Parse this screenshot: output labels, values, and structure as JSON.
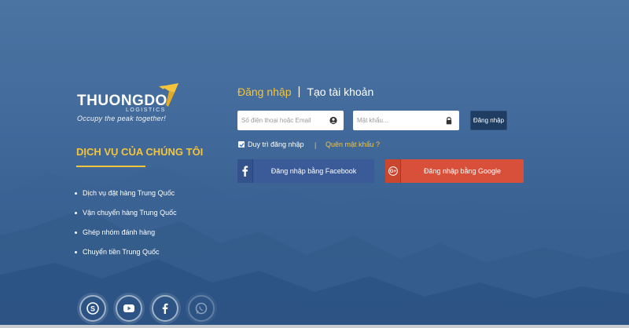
{
  "logo": {
    "name": "THUONGDO",
    "sub": "LOGISTICS",
    "tagline": "Occupy the peak together!"
  },
  "services": {
    "title": "DỊCH VỤ CỦA CHÚNG TÔI",
    "items": [
      {
        "label": "Dịch vụ đặt hàng Trung Quốc"
      },
      {
        "label": "Vận chuyển hàng Trung Quốc"
      },
      {
        "label": "Ghép nhóm đánh hàng"
      },
      {
        "label": "Chuyển tiền Trung Quốc"
      }
    ]
  },
  "social": [
    {
      "icon": "skype-icon"
    },
    {
      "icon": "youtube-icon"
    },
    {
      "icon": "facebook-icon"
    },
    {
      "icon": "whatsapp-icon"
    }
  ],
  "tabs": {
    "login": "Đăng nhập",
    "separator": "|",
    "register": "Tạo tài khoản"
  },
  "form": {
    "username_placeholder": "Số điện thoại hoặc Email",
    "username_value": "",
    "password_placeholder": "Mật khẩu...",
    "password_value": "",
    "login_button": "Đăng nhập",
    "remember_label": "Duy trì đăng nhập",
    "remember_checked": true,
    "divider": "|",
    "forgot_label": "Quên mật khẩu ?"
  },
  "social_login": {
    "facebook": "Đăng nhập bằng Facebook",
    "google": "Đăng nhập bằng Google"
  },
  "colors": {
    "accent": "#f5c43a",
    "background": "#3f6694",
    "facebook": "#3b5b98",
    "google": "#d9503a",
    "login_button": "#1f3d63"
  }
}
